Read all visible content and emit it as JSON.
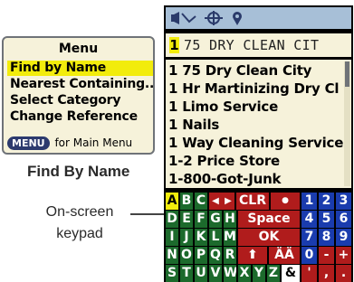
{
  "menu": {
    "title": "Menu",
    "items": [
      {
        "label": "Find by Name",
        "selected": true
      },
      {
        "label": "Nearest Containing...",
        "selected": false
      },
      {
        "label": "Select Category",
        "selected": false
      },
      {
        "label": "Change Reference",
        "selected": false
      }
    ],
    "footer_key": "MENU",
    "footer_text": "for Main Menu"
  },
  "captions": {
    "find_by_name": "Find By Name",
    "keypad_line1": "On-screen",
    "keypad_line2": "keypad"
  },
  "device": {
    "titlebar_icons": [
      "signal-icon",
      "gps-satellite-icon",
      "map-pin-icon"
    ],
    "search": {
      "cursor_char": "1",
      "text": "75 DRY CLEAN CIT"
    },
    "results": [
      "1 75 Dry Clean City",
      "1 Hr Martinizing Dry Cl",
      "1 Limo Service",
      "1 Nails",
      "1 Way Cleaning Service",
      "1-2 Price Store",
      "1-800-Got-Junk"
    ],
    "keypad": {
      "rows": [
        {
          "letters": [
            "A",
            "B",
            "C"
          ],
          "mid": [
            "◀",
            "▶",
            "CLR",
            "●"
          ],
          "nums": [
            "1",
            "2",
            "3"
          ]
        },
        {
          "letters": [
            "D",
            "E",
            "F",
            "G",
            "H"
          ],
          "mid": [
            "Space"
          ],
          "nums": [
            "4",
            "5",
            "6"
          ]
        },
        {
          "letters": [
            "I",
            "J",
            "K",
            "L",
            "M"
          ],
          "mid": [
            "OK"
          ],
          "nums": [
            "7",
            "8",
            "9"
          ]
        },
        {
          "letters": [
            "N",
            "O",
            "P",
            "Q",
            "R"
          ],
          "mid": [
            "⬆",
            "ÄÄ"
          ],
          "nums": [
            "0",
            "-",
            "+"
          ]
        },
        {
          "letters": [
            "S",
            "T",
            "U",
            "V",
            "W",
            "X",
            "Y",
            "Z"
          ],
          "mid": [
            "&",
            "'",
            ",",
            "."
          ],
          "nums": []
        }
      ],
      "selected_key": "A"
    }
  }
}
